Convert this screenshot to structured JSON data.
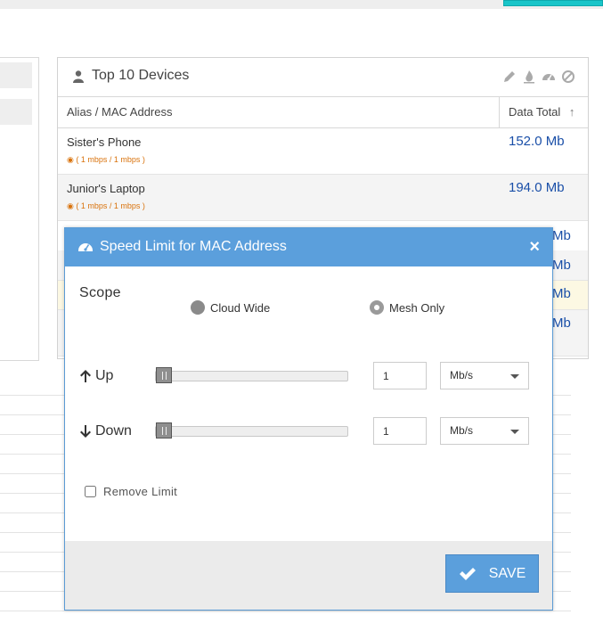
{
  "colors": {
    "accent": "#5b9fdc",
    "value": "#1a4fa8",
    "speed": "#d9730d"
  },
  "card": {
    "title": "Top 10 Devices",
    "tools": [
      "pencil-icon",
      "fire-icon",
      "gauge-icon",
      "ban-icon"
    ],
    "columns": {
      "alias": "Alias / MAC Address",
      "total": "Data Total",
      "sort_arrow": "↑"
    },
    "rows": [
      {
        "alias": "Sister's Phone",
        "speed": "( 1 mbps /  1 mbps )",
        "total": "152.0 Mb"
      },
      {
        "alias": "Junior's Laptop",
        "speed": "( 1 mbps /  1 mbps )",
        "total": "194.0 Mb"
      }
    ],
    "partial_totals": [
      "Mb",
      "Mb",
      "Mb",
      "Mb"
    ]
  },
  "modal": {
    "title": "Speed Limit for MAC Address",
    "close": "×",
    "scope_label": "Scope",
    "scope_options": [
      "Cloud Wide",
      "Mesh Only"
    ],
    "scope_selected": "Mesh Only",
    "up": {
      "label": "Up",
      "value": "1",
      "unit": "Mb/s",
      "level": 0
    },
    "down": {
      "label": "Down",
      "value": "1",
      "unit": "Mb/s",
      "level": 0
    },
    "remove_limit": "Remove Limit",
    "save": "SAVE"
  }
}
